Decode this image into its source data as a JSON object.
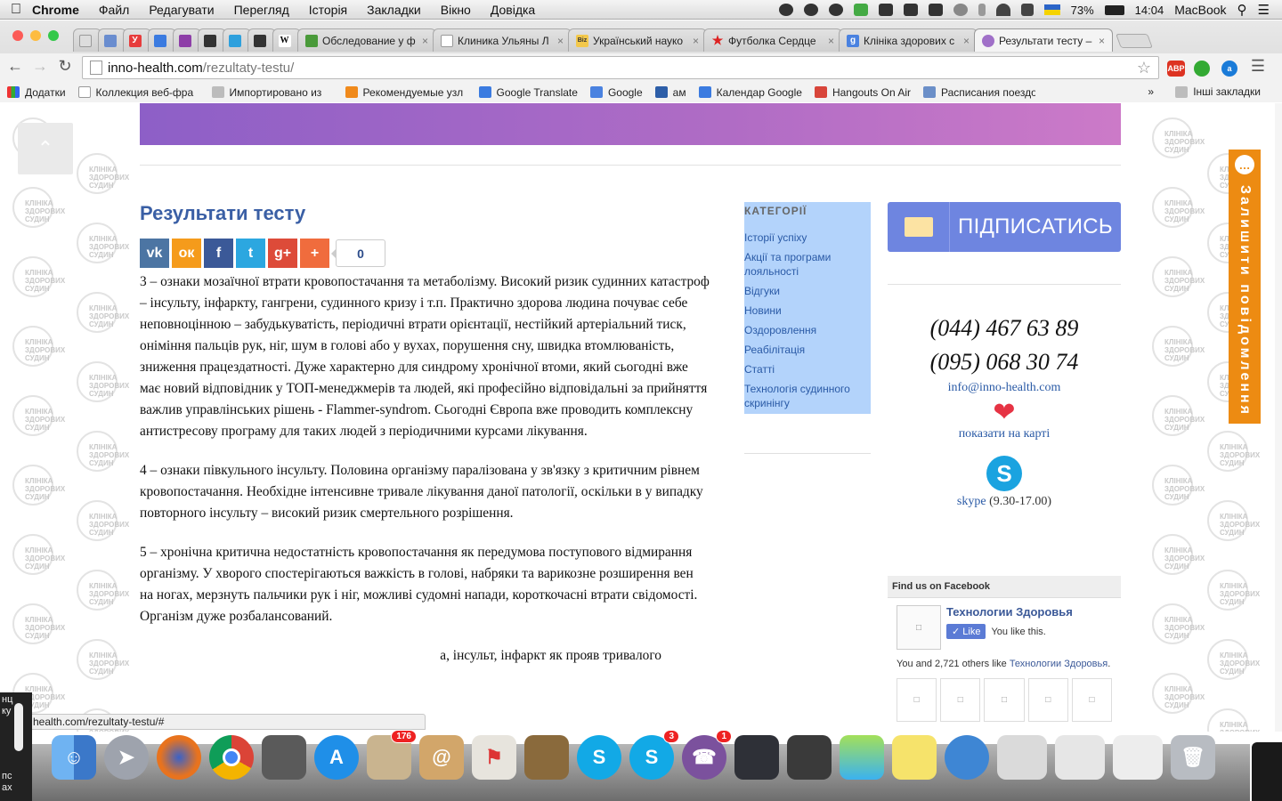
{
  "menubar": {
    "app": "Chrome",
    "menus": [
      "Файл",
      "Редагувати",
      "Перегляд",
      "Історія",
      "Закладки",
      "Вікно",
      "Довідка"
    ],
    "battery": "73%",
    "time": "14:04",
    "computer": "MacBook"
  },
  "tabs": [
    {
      "title": "Обследование у ф",
      "active": false
    },
    {
      "title": "Клиника Ульяны Л",
      "active": false
    },
    {
      "title": "Український науко",
      "active": false
    },
    {
      "title": "Футболка Сердце",
      "active": false
    },
    {
      "title": "Клініка здорових с",
      "active": false
    },
    {
      "title": "Результати тесту –",
      "active": true
    }
  ],
  "address": {
    "host": "inno-health.com",
    "path": "/rezultaty-testu/"
  },
  "extensions": {
    "abp": "ABP"
  },
  "bookmarks": [
    "Додатки",
    "Коллекция веб-фра",
    "Импортировано из",
    "Рекомендуемые узл",
    "Google Translate",
    "Google",
    "ам",
    "Календар Google",
    "Hangouts On Air",
    "Расписания поездо"
  ],
  "bookmarks_more": "»",
  "bookmarks_other": "Інші закладки",
  "watermark": {
    "line1": "КЛІНІКА",
    "line2": "ЗДОРОВИХ",
    "line3": "СУДИН"
  },
  "article": {
    "title": "Результати тесту",
    "share_count": "0",
    "share_buttons": [
      "vk",
      "ok",
      "facebook",
      "twitter",
      "google-plus",
      "more"
    ],
    "paragraphs": [
      "3 – ознаки мозаїчної втрати кровопостачання та метаболізму. Високий ризик судинних катастроф – інсульту, інфаркту, гангрени, судинного кризу і т.п.  Практично здорова людина почуває себе неповноцінною – забудькуватість, періодичні втрати орієнтації, нестійкий артеріальний тиск, оніміння пальців рук, ніг, шум в голові або у вухах, порушення сну, швидка втомлюваність, зниження працездатності. Дуже характерно для синдрому хронічної втоми, який сьогодні вже має новий відповідник у ТОП-менеджмерів та людей, які професійно відповідальні за прийняття важлив управлінських рішень -   Flammer-syndrom. Сьогодні Європа вже проводить комплексну антистресову програму для таких людей з періодичними курсами лікування.",
      "4 – ознаки півкульного інсульту. Половина організму паралізована у зв'язку з критичним рівнем кровопостачання. Необхідне інтенсивне тривале лікування даної патології, оскільки в у випадку повторного інсульту – високий ризик смертельного розрішення.",
      "5 – хронічна критична недостатність кровопостачання як передумова поступового відмирання  організму.  У хворого спостерігаються важкість в голові, набряки та варикозне розширення вен на ногах, мерзнуть пальчики рук і ніг, можливі судомні напади, короткочасні втрати свідомості. Організм дуже розбалансований.",
      "а, інсульт, інфаркт як прояв тривалого"
    ]
  },
  "categories": {
    "heading": "КАТЕГОРІЇ",
    "items": [
      "Історії успіху",
      "Акції та програми лояльності",
      "Відгуки",
      "Новини",
      "Оздоровлення",
      "Реабілітація",
      "Статті",
      "Технологія судинного скринінгу"
    ]
  },
  "sidebar": {
    "subscribe": "ПІДПИСАТИСЬ",
    "phone1": "(044) 467 63 89",
    "phone2": "(095) 068 30 74",
    "email": "info@inno-health.com",
    "map_link": "показати на карті",
    "skype_link": "skype",
    "skype_hours": " (9.30-17.00)"
  },
  "facebook": {
    "header": "Find us on Facebook",
    "page_name": "Технологии Здоровья",
    "like": "Like",
    "you_like": "You like this.",
    "others_prefix": "You and 2,721 others like ",
    "others_page": "Технологии Здоровья",
    "others_suffix": "."
  },
  "feedback_tab": "Залишити повідомлення",
  "status_url": "health.com/rezultaty-testu/#",
  "dock_badges": {
    "mail": "176",
    "skype": "3",
    "viber": "1"
  },
  "left_panel_text": [
    "нц",
    "ку",
    "пс",
    "ах"
  ]
}
